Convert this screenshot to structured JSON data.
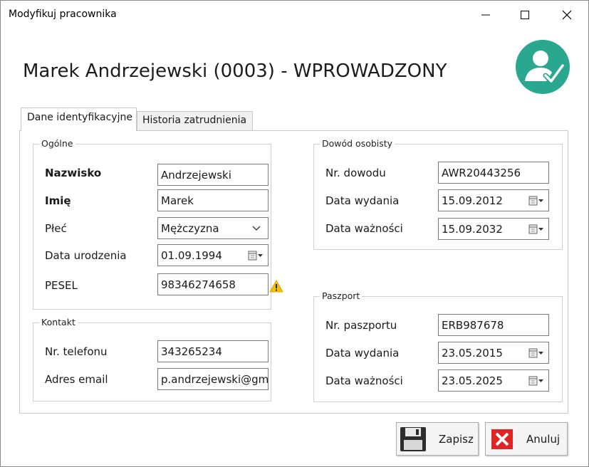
{
  "window": {
    "title": "Modyfikuj pracownika"
  },
  "header": {
    "title": "Marek Andrzejewski (0003) - WPROWADZONY",
    "icon": "user-check-icon"
  },
  "tabs": [
    {
      "label": "Dane identyfikacyjne",
      "active": true
    },
    {
      "label": "Historia zatrudnienia",
      "active": false
    }
  ],
  "general": {
    "title": "Ogólne",
    "surname_label": "Nazwisko",
    "surname_value": "Andrzejewski",
    "name_label": "Imię",
    "name_value": "Marek",
    "gender_label": "Płeć",
    "gender_value": "Mężczyzna",
    "birthdate_label": "Data urodzenia",
    "birthdate_value": "01.09.1994",
    "pesel_label": "PESEL",
    "pesel_value": "98346274658"
  },
  "contact": {
    "title": "Kontakt",
    "phone_label": "Nr. telefonu",
    "phone_value": "343265234",
    "email_label": "Adres email",
    "email_value": "p.andrzejewski@gm"
  },
  "id_card": {
    "title": "Dowód osobisty",
    "number_label": "Nr. dowodu",
    "number_value": "AWR20443256",
    "issue_label": "Data wydania",
    "issue_value": "15.09.2012",
    "expiry_label": "Data ważności",
    "expiry_value": "15.09.2032"
  },
  "passport": {
    "title": "Paszport",
    "number_label": "Nr. paszportu",
    "number_value": "ERB987678",
    "issue_label": "Data wydania",
    "issue_value": "23.05.2015",
    "expiry_label": "Data ważności",
    "expiry_value": "23.05.2025"
  },
  "buttons": {
    "save_label": "Zapisz",
    "cancel_label": "Anuluj"
  },
  "colors": {
    "accent_teal": "#2aa88f",
    "cancel_red": "#e02424",
    "warning_yellow": "#f2c200"
  }
}
